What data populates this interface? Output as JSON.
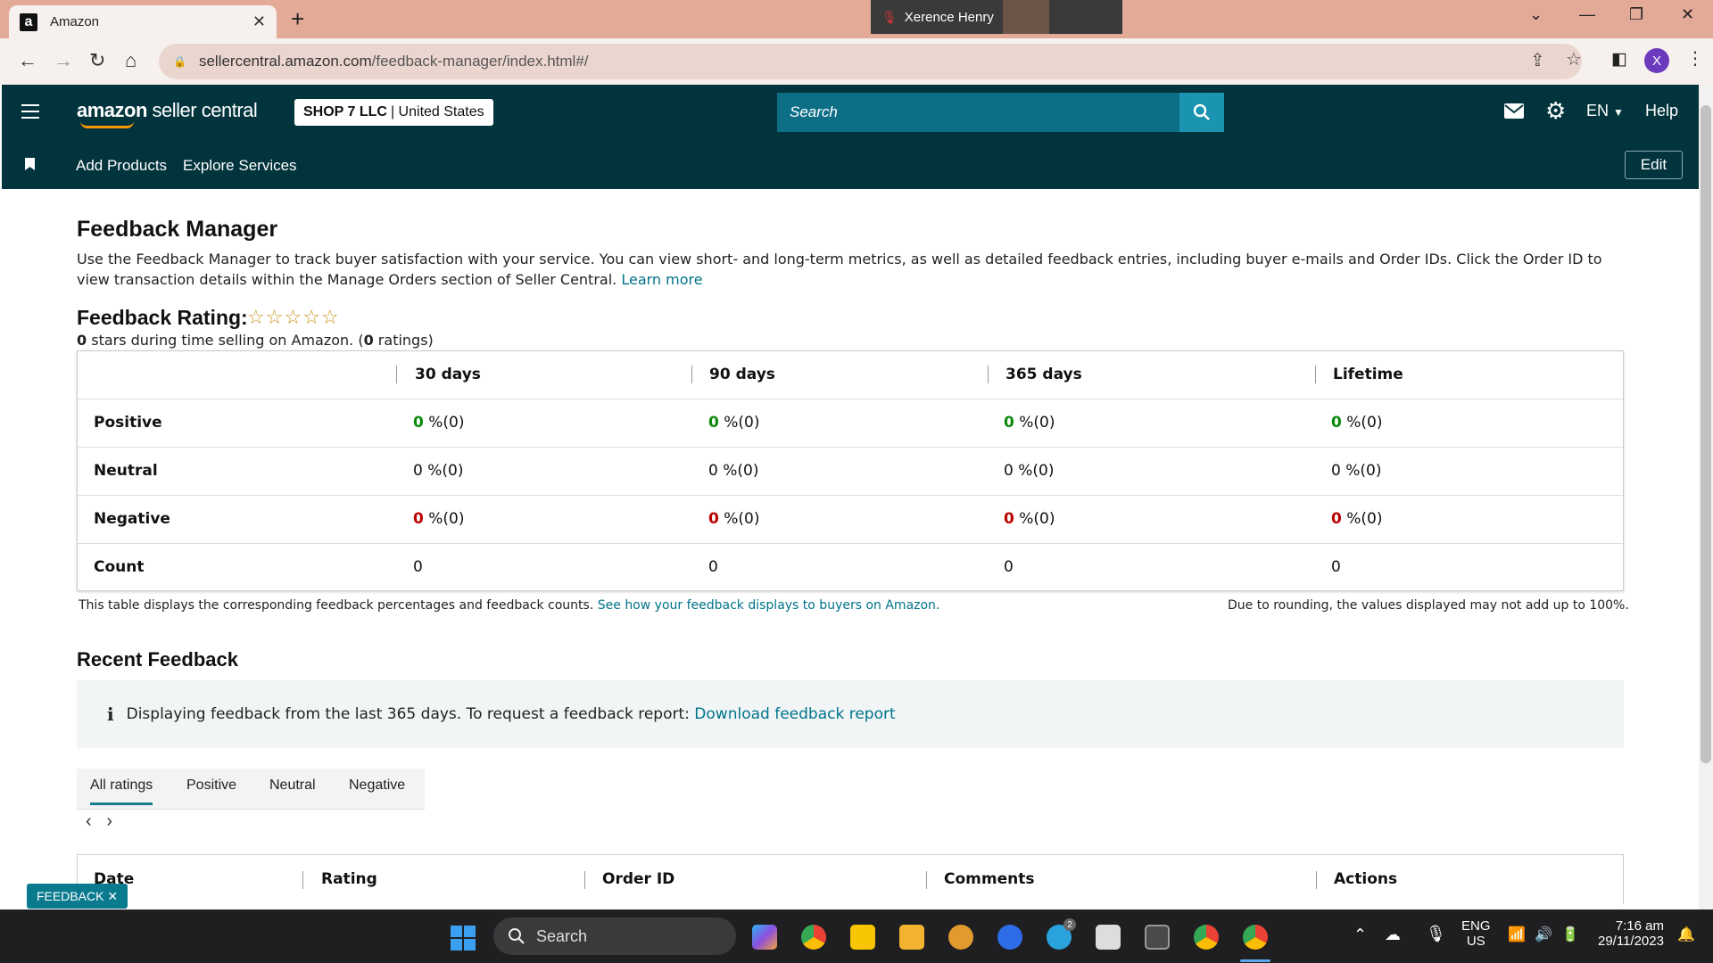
{
  "browser": {
    "tab_title": "Amazon",
    "tab_favicon": "a",
    "video_call_name": "Xerence Henry",
    "url_domain": "sellercentral.amazon.com",
    "url_path": "/feedback-manager/index.html#/",
    "profile_initial": "X"
  },
  "header": {
    "logo_main": "amazon",
    "logo_sub": "seller central",
    "store_name": "SHOP 7 LLC",
    "store_region": "| United States",
    "search_placeholder": "Search",
    "language": "EN",
    "help": "Help"
  },
  "navbar": {
    "links": [
      "Add Products",
      "Explore Services"
    ],
    "edit": "Edit"
  },
  "page": {
    "title": "Feedback Manager",
    "description": "Use the Feedback Manager to track buyer satisfaction with your service. You can view short- and long-term metrics, as well as detailed feedback entries, including buyer e-mails and Order IDs. Click the Order ID to view transaction details within the Manage Orders section of Seller Central.",
    "learn_more": "Learn more",
    "rating_label": "Feedback Rating:",
    "rating_stars": 0,
    "rating_summary_stars": "0",
    "rating_summary_mid": " stars during time selling on Amazon. (",
    "rating_summary_count": "0",
    "rating_summary_end": " ratings)"
  },
  "feedback_table": {
    "columns": [
      "30 days",
      "90 days",
      "365 days",
      "Lifetime"
    ],
    "rows": {
      "positive": {
        "label": "Positive",
        "values": [
          "0",
          "0",
          "0",
          "0"
        ],
        "suffix": " %(0)"
      },
      "neutral": {
        "label": "Neutral",
        "values": [
          "0",
          "0",
          "0",
          "0"
        ],
        "suffix": " %(0)"
      },
      "negative": {
        "label": "Negative",
        "values": [
          "0",
          "0",
          "0",
          "0"
        ],
        "suffix": " %(0)"
      },
      "count": {
        "label": "Count",
        "values": [
          "0",
          "0",
          "0",
          "0"
        ]
      }
    },
    "footnote": "This table displays the corresponding feedback percentages and feedback counts.",
    "footnote_link": "See how your feedback displays to buyers on Amazon.",
    "rounding_note": "Due to rounding, the values displayed may not add up to 100%."
  },
  "recent": {
    "title": "Recent Feedback",
    "info_text": "Displaying feedback from the last 365 days. To request a feedback report:",
    "info_link": "Download feedback report",
    "tabs": [
      "All ratings",
      "Positive",
      "Neutral",
      "Negative"
    ],
    "columns": [
      "Date",
      "Rating",
      "Order ID",
      "Comments",
      "Actions"
    ]
  },
  "feedback_tag": "FEEDBACK",
  "taskbar": {
    "search": "Search",
    "lang_top": "ENG",
    "lang_bottom": "US",
    "time": "7:16 am",
    "date": "29/11/2023",
    "telegram_badge": "2"
  },
  "colors": {
    "header_bg": "#02343d",
    "accent": "#00738a",
    "positive": "#0a8a0a",
    "negative": "#b00000",
    "tabstrip": "#e3aa97"
  }
}
